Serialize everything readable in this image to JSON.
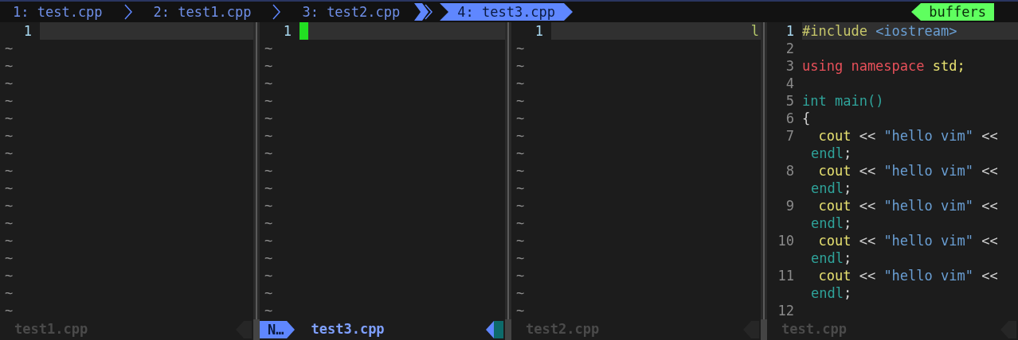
{
  "tabs": [
    {
      "label": "1: test.cpp",
      "selected": false
    },
    {
      "label": "2: test1.cpp",
      "selected": false
    },
    {
      "label": "3: test2.cpp",
      "selected": false
    },
    {
      "label": "4: test3.cpp",
      "selected": true
    }
  ],
  "buffers_label": "buffers",
  "panes": [
    {
      "active": false,
      "cursor": false,
      "rows": [
        {
          "kind": "line",
          "number": "1",
          "tokens": []
        },
        {
          "kind": "filler",
          "text": "~"
        },
        {
          "kind": "filler",
          "text": "~"
        },
        {
          "kind": "filler",
          "text": "~"
        },
        {
          "kind": "filler",
          "text": "~"
        },
        {
          "kind": "filler",
          "text": "~"
        },
        {
          "kind": "filler",
          "text": "~"
        },
        {
          "kind": "filler",
          "text": "~"
        },
        {
          "kind": "filler",
          "text": "~"
        },
        {
          "kind": "filler",
          "text": "~"
        },
        {
          "kind": "filler",
          "text": "~"
        },
        {
          "kind": "filler",
          "text": "~"
        },
        {
          "kind": "filler",
          "text": "~"
        },
        {
          "kind": "filler",
          "text": "~"
        },
        {
          "kind": "filler",
          "text": "~"
        },
        {
          "kind": "filler",
          "text": "~"
        },
        {
          "kind": "filler",
          "text": "~"
        }
      ],
      "status": {
        "file": "test1.cpp"
      }
    },
    {
      "active": true,
      "cursor": true,
      "rows": [
        {
          "kind": "line",
          "number": "1",
          "tokens": []
        },
        {
          "kind": "filler",
          "text": "~"
        },
        {
          "kind": "filler",
          "text": "~"
        },
        {
          "kind": "filler",
          "text": "~"
        },
        {
          "kind": "filler",
          "text": "~"
        },
        {
          "kind": "filler",
          "text": "~"
        },
        {
          "kind": "filler",
          "text": "~"
        },
        {
          "kind": "filler",
          "text": "~"
        },
        {
          "kind": "filler",
          "text": "~"
        },
        {
          "kind": "filler",
          "text": "~"
        },
        {
          "kind": "filler",
          "text": "~"
        },
        {
          "kind": "filler",
          "text": "~"
        },
        {
          "kind": "filler",
          "text": "~"
        },
        {
          "kind": "filler",
          "text": "~"
        },
        {
          "kind": "filler",
          "text": "~"
        },
        {
          "kind": "filler",
          "text": "~"
        },
        {
          "kind": "filler",
          "text": "~"
        }
      ],
      "status": {
        "mode": "N…",
        "file": "test3.cpp"
      }
    },
    {
      "active": false,
      "cursor": false,
      "trailing": "l",
      "rows": [
        {
          "kind": "line",
          "number": "1",
          "tokens": []
        },
        {
          "kind": "filler",
          "text": "~"
        },
        {
          "kind": "filler",
          "text": "~"
        },
        {
          "kind": "filler",
          "text": "~"
        },
        {
          "kind": "filler",
          "text": "~"
        },
        {
          "kind": "filler",
          "text": "~"
        },
        {
          "kind": "filler",
          "text": "~"
        },
        {
          "kind": "filler",
          "text": "~"
        },
        {
          "kind": "filler",
          "text": "~"
        },
        {
          "kind": "filler",
          "text": "~"
        },
        {
          "kind": "filler",
          "text": "~"
        },
        {
          "kind": "filler",
          "text": "~"
        },
        {
          "kind": "filler",
          "text": "~"
        },
        {
          "kind": "filler",
          "text": "~"
        },
        {
          "kind": "filler",
          "text": "~"
        },
        {
          "kind": "filler",
          "text": "~"
        },
        {
          "kind": "filler",
          "text": "~"
        }
      ],
      "status": {
        "file": "test2.cpp"
      }
    },
    {
      "active": false,
      "cursor": false,
      "rows": [
        {
          "kind": "line",
          "number": "1",
          "tokens": [
            {
              "text": "#include ",
              "kind": "preproc"
            },
            {
              "text": "<iostream>",
              "kind": "string"
            }
          ]
        },
        {
          "kind": "line",
          "number": "2",
          "tokens": []
        },
        {
          "kind": "line",
          "number": "3",
          "tokens": [
            {
              "text": "using namespace ",
              "kind": "keyword"
            },
            {
              "text": "std;",
              "kind": "ident"
            }
          ]
        },
        {
          "kind": "line",
          "number": "4",
          "tokens": []
        },
        {
          "kind": "line",
          "number": "5",
          "tokens": [
            {
              "text": "int ",
              "kind": "type"
            },
            {
              "text": "main()",
              "kind": "type"
            }
          ]
        },
        {
          "kind": "line",
          "number": "6",
          "tokens": [
            {
              "text": "{",
              "kind": "plain"
            }
          ]
        },
        {
          "kind": "line",
          "number": "7",
          "tokens": [
            {
              "text": "  cout",
              "kind": "ident"
            },
            {
              "text": " << ",
              "kind": "plain"
            },
            {
              "text": "\"hello vim\"",
              "kind": "string"
            },
            {
              "text": " <<",
              "kind": "plain"
            }
          ]
        },
        {
          "kind": "wrap",
          "tokens": [
            {
              "text": "endl",
              "kind": "type"
            },
            {
              "text": ";",
              "kind": "plain"
            }
          ]
        },
        {
          "kind": "line",
          "number": "8",
          "tokens": [
            {
              "text": "  cout",
              "kind": "ident"
            },
            {
              "text": " << ",
              "kind": "plain"
            },
            {
              "text": "\"hello vim\"",
              "kind": "string"
            },
            {
              "text": " <<",
              "kind": "plain"
            }
          ]
        },
        {
          "kind": "wrap",
          "tokens": [
            {
              "text": "endl",
              "kind": "type"
            },
            {
              "text": ";",
              "kind": "plain"
            }
          ]
        },
        {
          "kind": "line",
          "number": "9",
          "tokens": [
            {
              "text": "  cout",
              "kind": "ident"
            },
            {
              "text": " << ",
              "kind": "plain"
            },
            {
              "text": "\"hello vim\"",
              "kind": "string"
            },
            {
              "text": " <<",
              "kind": "plain"
            }
          ]
        },
        {
          "kind": "wrap",
          "tokens": [
            {
              "text": "endl",
              "kind": "type"
            },
            {
              "text": ";",
              "kind": "plain"
            }
          ]
        },
        {
          "kind": "line",
          "number": "10",
          "tokens": [
            {
              "text": "  cout",
              "kind": "ident"
            },
            {
              "text": " << ",
              "kind": "plain"
            },
            {
              "text": "\"hello vim\"",
              "kind": "string"
            },
            {
              "text": " <<",
              "kind": "plain"
            }
          ]
        },
        {
          "kind": "wrap",
          "tokens": [
            {
              "text": "endl",
              "kind": "type"
            },
            {
              "text": ";",
              "kind": "plain"
            }
          ]
        },
        {
          "kind": "line",
          "number": "11",
          "tokens": [
            {
              "text": "  cout",
              "kind": "ident"
            },
            {
              "text": " << ",
              "kind": "plain"
            },
            {
              "text": "\"hello vim\"",
              "kind": "string"
            },
            {
              "text": " <<",
              "kind": "plain"
            }
          ]
        },
        {
          "kind": "wrap",
          "tokens": [
            {
              "text": "endl",
              "kind": "type"
            },
            {
              "text": ";",
              "kind": "plain"
            }
          ]
        },
        {
          "kind": "line",
          "number": "12",
          "tokens": []
        }
      ],
      "status": {
        "file": "test.cpp"
      }
    }
  ]
}
